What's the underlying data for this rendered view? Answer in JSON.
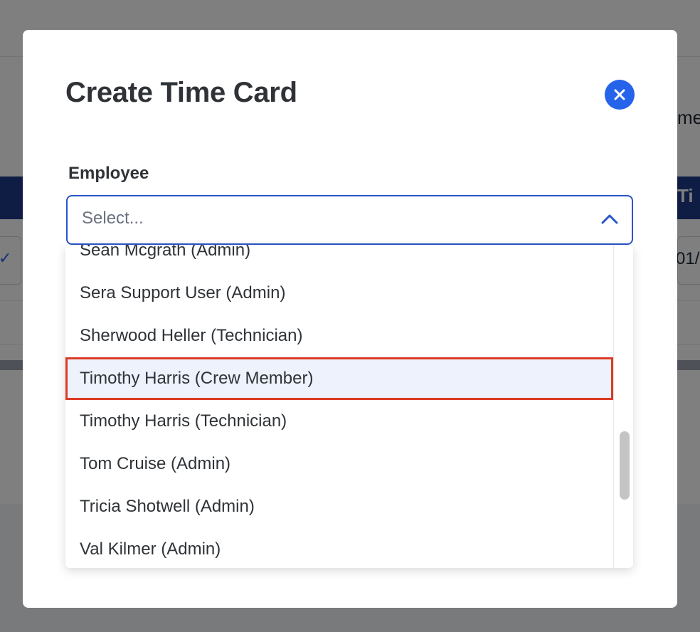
{
  "background": {
    "side_text": "me",
    "header_text": "Ti",
    "right_cell_text": "01/"
  },
  "modal": {
    "title": "Create Time Card",
    "close_icon": "close-icon",
    "employee_field": {
      "label": "Employee",
      "placeholder": "Select...",
      "chevron_icon": "chevron-up-icon",
      "options": [
        "Sean Mcgrath (Admin)",
        "Sera Support User (Admin)",
        "Sherwood Heller (Technician)",
        "Timothy Harris (Crew Member)",
        "Timothy Harris (Technician)",
        "Tom Cruise (Admin)",
        "Tricia Shotwell (Admin)",
        "Val Kilmer (Admin)"
      ],
      "focused_option": "Timothy Harris (Crew Member)"
    }
  },
  "colors": {
    "accent": "#2563eb",
    "title_text": "#2f3337",
    "focus_outline": "#dc3b26",
    "focused_bg": "#eef2fc",
    "header_band": "#1e3a8a"
  }
}
